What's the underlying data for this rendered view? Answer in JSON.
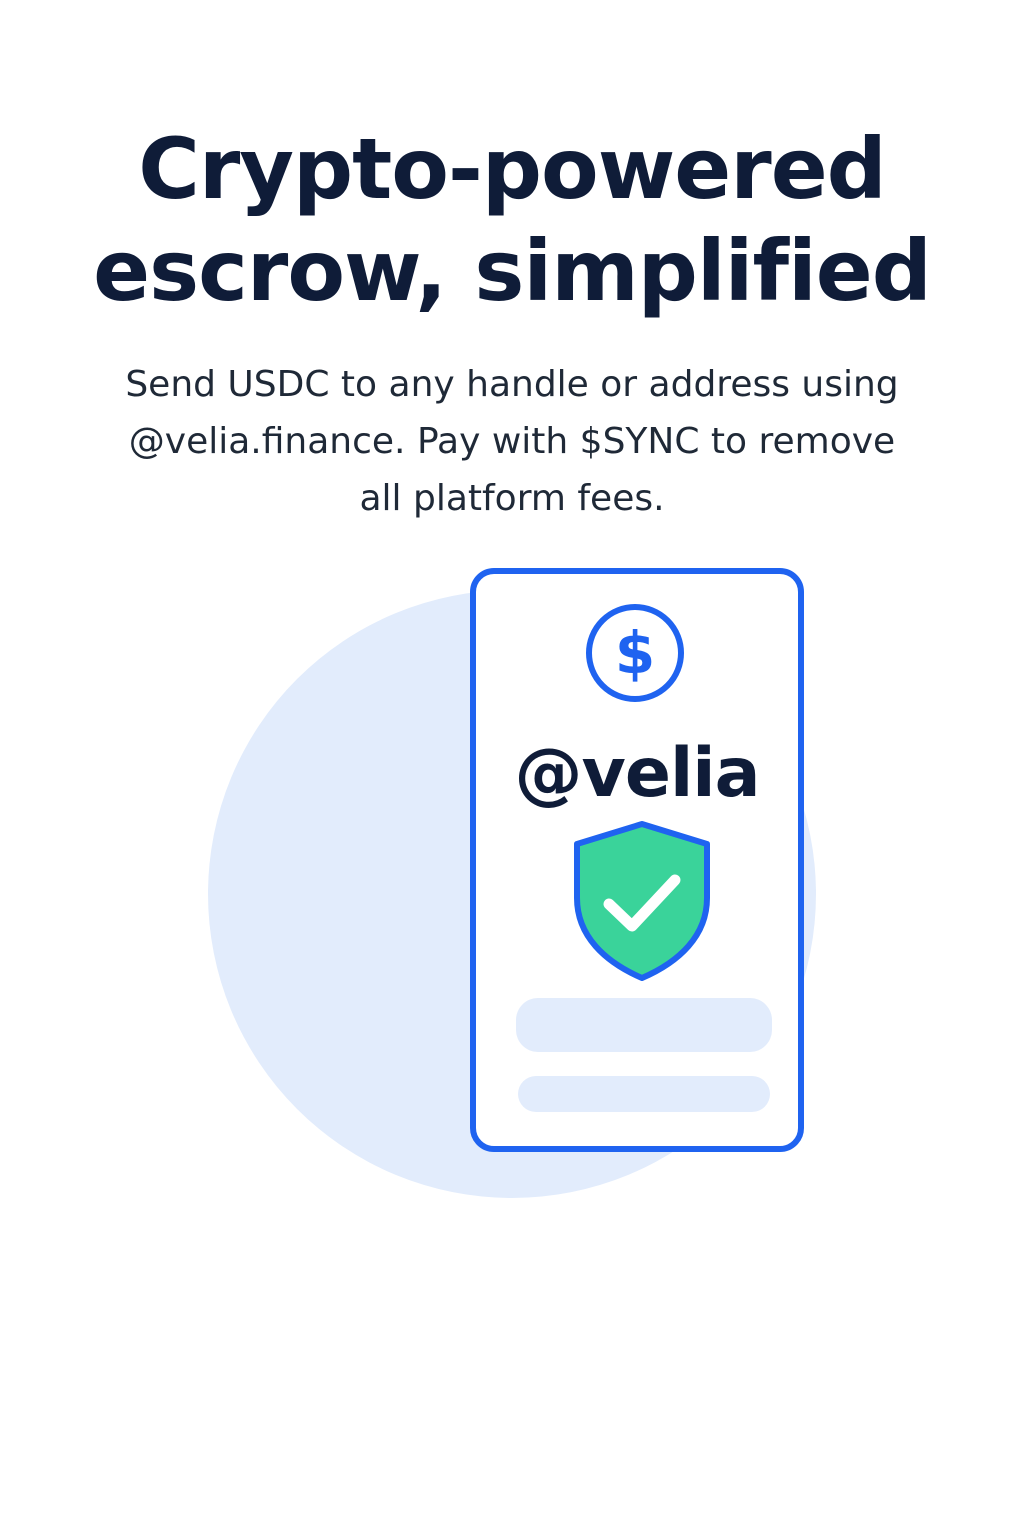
{
  "hero": {
    "headline_line1": "Crypto-powered",
    "headline_line2": "escrow, simplified",
    "subhead_line1": "Send USDC to any handle or address using",
    "subhead_line2": "@velia.finance. Pay with $SYNC to remove",
    "subhead_line3": "all platform fees."
  },
  "illustration": {
    "coin_symbol": "$",
    "handle": "@velia",
    "icons": [
      "dollar-coin-icon",
      "shield-check-icon"
    ]
  },
  "colors": {
    "headline": "#0f1c38",
    "accent_blue": "#1f63f0",
    "shield_green": "#3ad39a",
    "light_blue": "#e2ecfc"
  }
}
